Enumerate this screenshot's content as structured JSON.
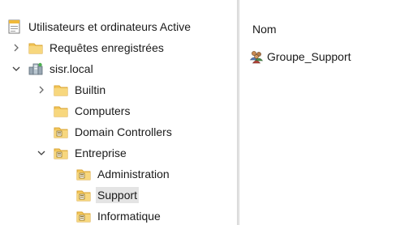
{
  "tree": {
    "root": {
      "label": "Utilisateurs et ordinateurs Active",
      "icon": "aduc-console-icon"
    },
    "saved_queries": {
      "label": "Requêtes enregistrées",
      "icon": "folder-icon",
      "expanded": false
    },
    "domain": {
      "label": "sisr.local",
      "icon": "domain-icon",
      "expanded": true
    },
    "builtin": {
      "label": "Builtin",
      "icon": "folder-icon",
      "expanded": false
    },
    "computers": {
      "label": "Computers",
      "icon": "folder-icon"
    },
    "domain_controllers": {
      "label": "Domain Controllers",
      "icon": "ou-icon"
    },
    "entreprise": {
      "label": "Entreprise",
      "icon": "ou-icon",
      "expanded": true
    },
    "administration": {
      "label": "Administration",
      "icon": "ou-icon"
    },
    "support": {
      "label": "Support",
      "icon": "ou-icon",
      "selected": true
    },
    "informatique": {
      "label": "Informatique",
      "icon": "ou-icon"
    }
  },
  "list": {
    "column_header": "Nom",
    "items": [
      {
        "label": "Groupe_Support",
        "icon": "group-icon"
      }
    ]
  },
  "colors": {
    "folder": "#f3c65a",
    "folder_dark": "#d9a635",
    "selection": "#e4e4e4",
    "splitter": "#e9e9e9"
  }
}
